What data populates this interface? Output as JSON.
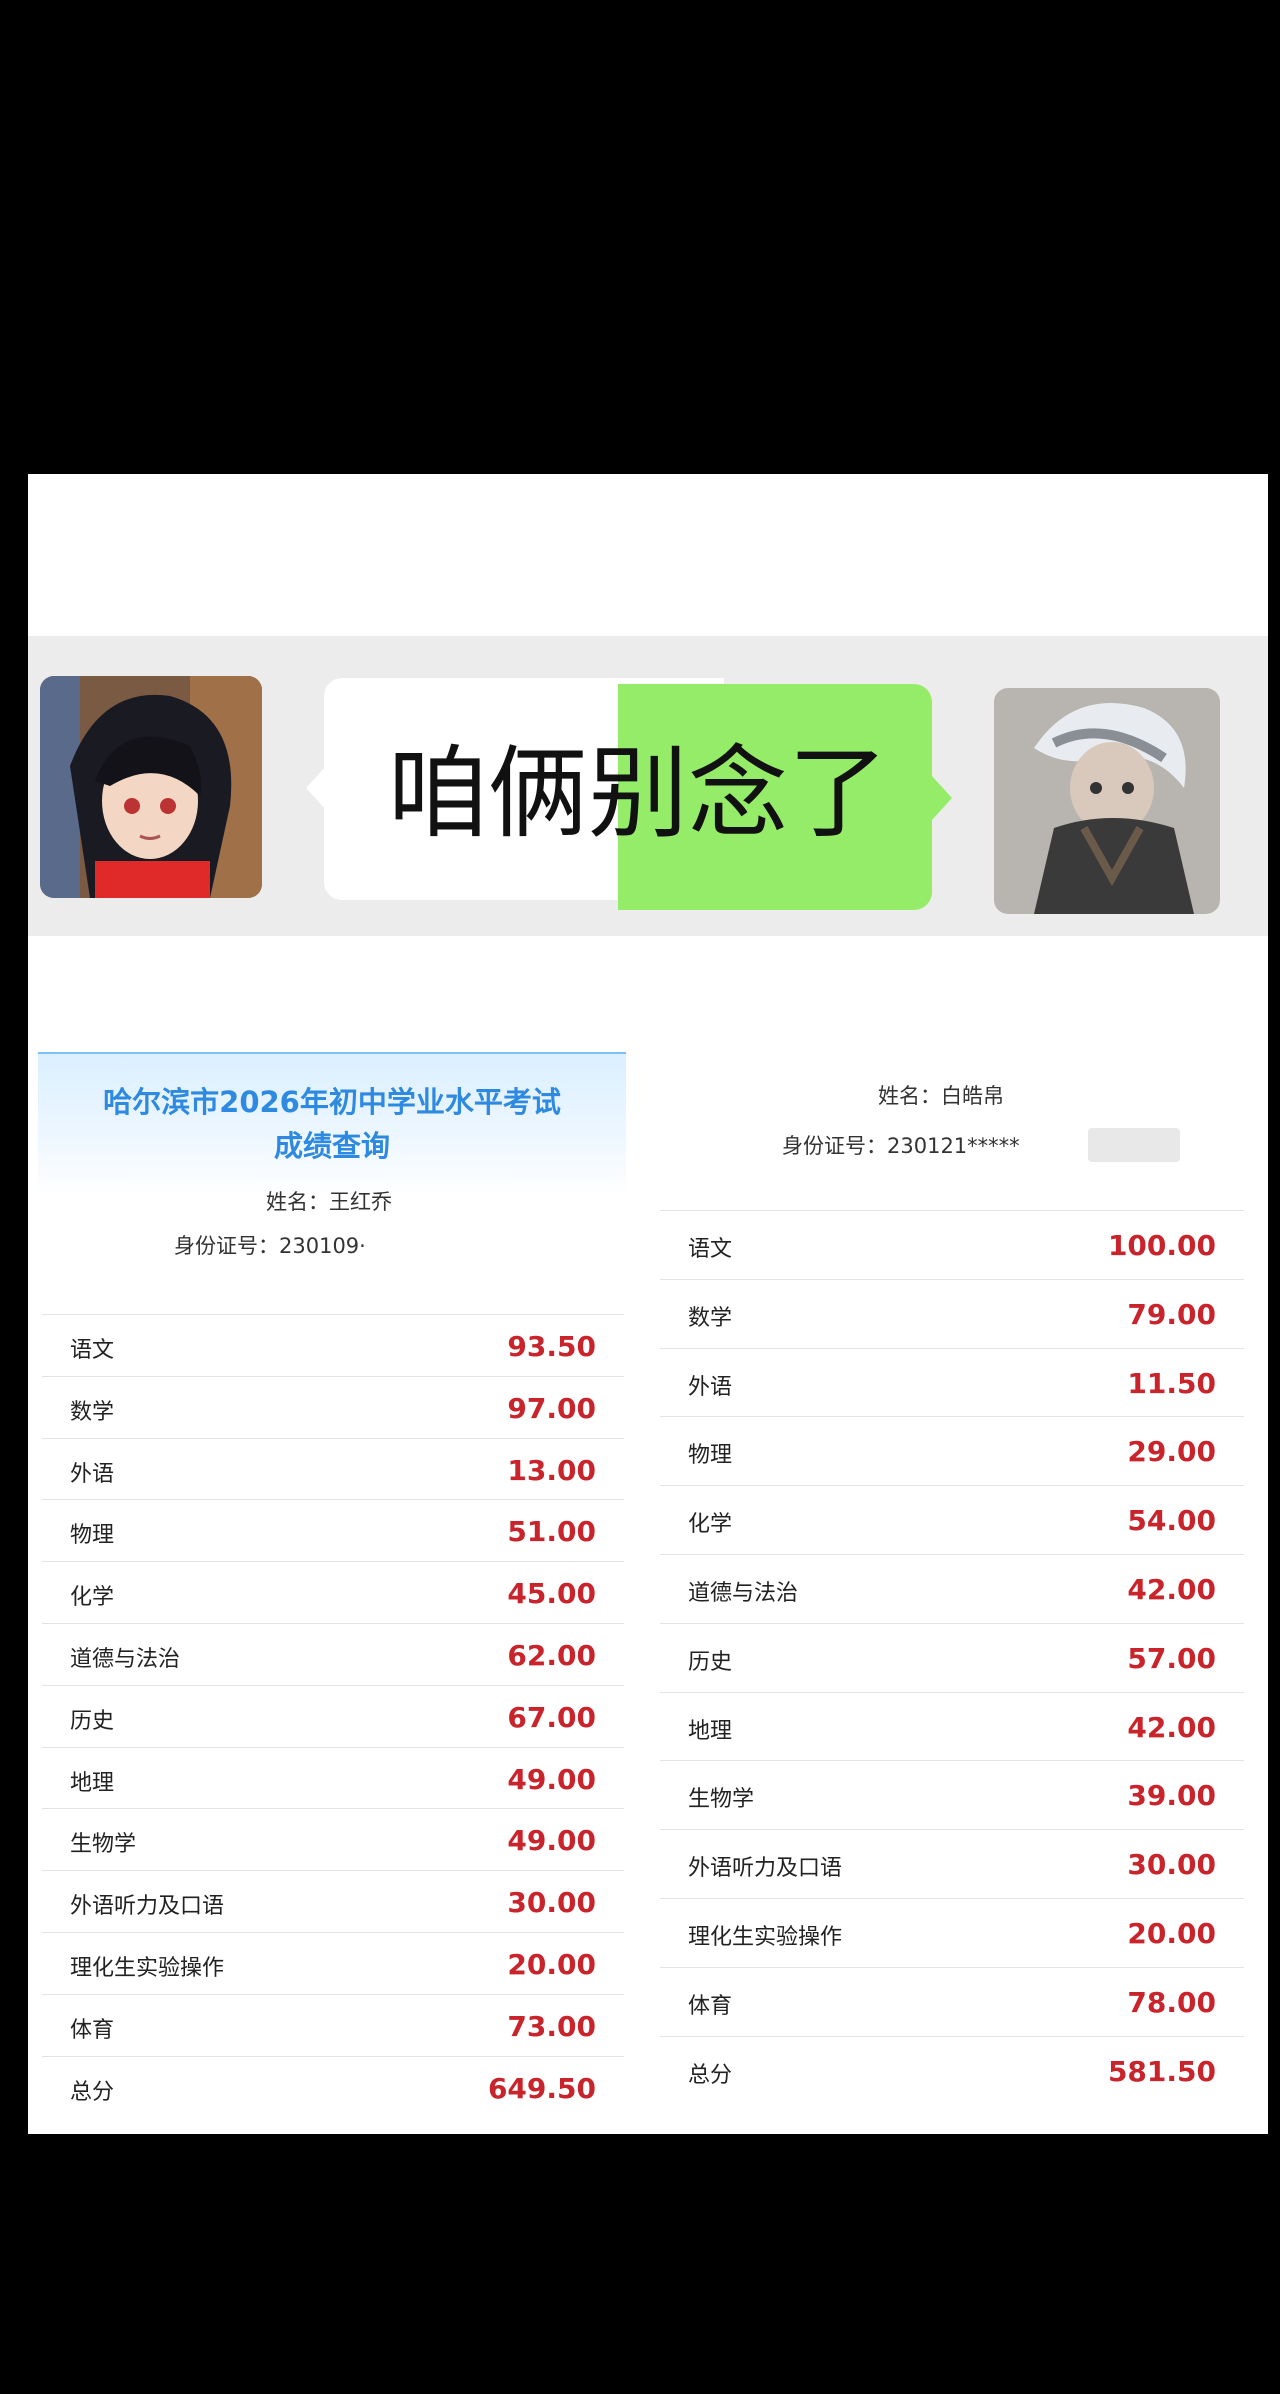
{
  "chat": {
    "message": "咱俩别念了"
  },
  "left_card": {
    "title_line1": "哈尔滨市2026年初中学业水平考试",
    "title_line2": "成绩查询",
    "name_label": "姓名：",
    "name_value": "王红乔",
    "id_label": "身份证号：",
    "id_value": "230109·",
    "rows": [
      {
        "subject": "语文",
        "score": "93.50"
      },
      {
        "subject": "数学",
        "score": "97.00"
      },
      {
        "subject": "外语",
        "score": "13.00"
      },
      {
        "subject": "物理",
        "score": "51.00"
      },
      {
        "subject": "化学",
        "score": "45.00"
      },
      {
        "subject": "道德与法治",
        "score": "62.00"
      },
      {
        "subject": "历史",
        "score": "67.00"
      },
      {
        "subject": "地理",
        "score": "49.00"
      },
      {
        "subject": "生物学",
        "score": "49.00"
      },
      {
        "subject": "外语听力及口语",
        "score": "30.00"
      },
      {
        "subject": "理化生实验操作",
        "score": "20.00"
      },
      {
        "subject": "体育",
        "score": "73.00"
      },
      {
        "subject": "总分",
        "score": "649.50"
      }
    ]
  },
  "right_card": {
    "name_label": "姓名：",
    "name_value": "白皓帛",
    "id_label": "身份证号：",
    "id_value": "230121*****",
    "rows": [
      {
        "subject": "语文",
        "score": "100.00"
      },
      {
        "subject": "数学",
        "score": "79.00"
      },
      {
        "subject": "外语",
        "score": "11.50"
      },
      {
        "subject": "物理",
        "score": "29.00"
      },
      {
        "subject": "化学",
        "score": "54.00"
      },
      {
        "subject": "道德与法治",
        "score": "42.00"
      },
      {
        "subject": "历史",
        "score": "57.00"
      },
      {
        "subject": "地理",
        "score": "42.00"
      },
      {
        "subject": "生物学",
        "score": "39.00"
      },
      {
        "subject": "外语听力及口语",
        "score": "30.00"
      },
      {
        "subject": "理化生实验操作",
        "score": "20.00"
      },
      {
        "subject": "体育",
        "score": "78.00"
      },
      {
        "subject": "总分",
        "score": "581.50"
      }
    ]
  },
  "colors": {
    "score_red": "#c9242b",
    "title_blue": "#2d8ae0",
    "bubble_green": "#95ec69",
    "background": "#000000"
  }
}
